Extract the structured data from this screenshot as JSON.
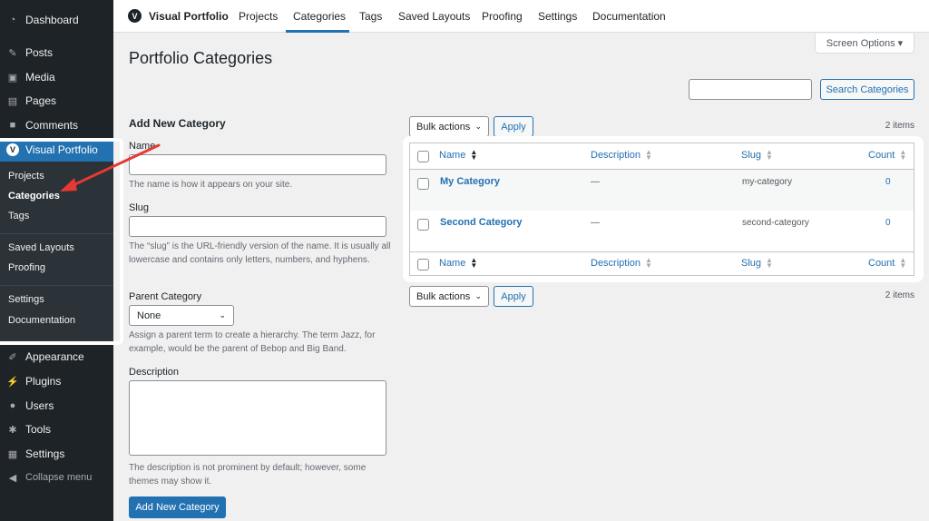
{
  "sidebar": {
    "top_items": [
      {
        "label": "Dashboard",
        "icon": "dashboard-icon"
      },
      {
        "label": "Posts",
        "icon": "pin-icon"
      },
      {
        "label": "Media",
        "icon": "media-icon"
      },
      {
        "label": "Pages",
        "icon": "pages-icon"
      },
      {
        "label": "Comments",
        "icon": "comments-icon"
      }
    ],
    "active": {
      "label": "Visual Portfolio",
      "logo": "V"
    },
    "submenu": [
      "Projects",
      "Categories",
      "Tags",
      "Saved Layouts",
      "Proofing",
      "Settings",
      "Documentation"
    ],
    "current_sub": "Categories",
    "bottom_items": [
      {
        "label": "Appearance",
        "icon": "brush-icon"
      },
      {
        "label": "Plugins",
        "icon": "plugin-icon"
      },
      {
        "label": "Users",
        "icon": "users-icon"
      },
      {
        "label": "Tools",
        "icon": "wrench-icon"
      },
      {
        "label": "Settings",
        "icon": "settings-icon"
      },
      {
        "label": "Collapse menu",
        "icon": "collapse-icon"
      }
    ]
  },
  "topnav": {
    "brand": "Visual Portfolio",
    "logo": "V",
    "items": [
      "Projects",
      "Categories",
      "Tags",
      "Saved Layouts",
      "Proofing",
      "Settings",
      "Documentation"
    ],
    "active": "Categories"
  },
  "screen_options": "Screen Options ▾",
  "page_title": "Portfolio Categories",
  "search": {
    "button": "Search Categories",
    "value": ""
  },
  "form": {
    "heading": "Add New Category",
    "name_label": "Name",
    "name_help": "The name is how it appears on your site.",
    "slug_label": "Slug",
    "slug_help": "The “slug” is the URL-friendly version of the name. It is usually all lowercase and contains only letters, numbers, and hyphens.",
    "parent_label": "Parent Category",
    "parent_value": "None",
    "parent_help": "Assign a parent term to create a hierarchy. The term Jazz, for example, would be the parent of Bebop and Big Band.",
    "description_label": "Description",
    "description_help": "The description is not prominent by default; however, some themes may show it.",
    "submit": "Add New Category"
  },
  "table": {
    "bulk_actions": "Bulk actions",
    "apply": "Apply",
    "items_count": "2 items",
    "columns": [
      "Name",
      "Description",
      "Slug",
      "Count"
    ],
    "rows": [
      {
        "name": "My Category",
        "description": "—",
        "slug": "my-category",
        "count": "0"
      },
      {
        "name": "Second Category",
        "description": "—",
        "slug": "second-category",
        "count": "0"
      }
    ]
  },
  "colors": {
    "accent": "#2271b1",
    "sidebar": "#1d2327",
    "annotation": "#e53935"
  }
}
